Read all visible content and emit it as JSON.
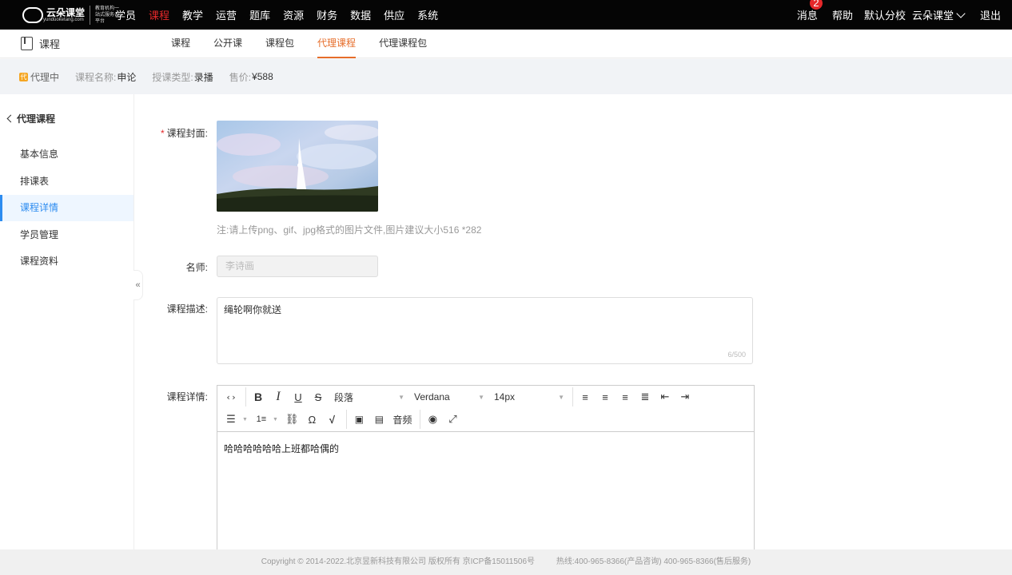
{
  "brand": {
    "name": "云朵课堂",
    "domain_text": "yunduoketang.com",
    "tagline": "教育机构一站式服务云平台"
  },
  "nav": {
    "items": [
      "学员",
      "课程",
      "教学",
      "运营",
      "题库",
      "资源",
      "财务",
      "数据",
      "供应",
      "系统"
    ],
    "active": "课程"
  },
  "right_nav": {
    "messages": "消息",
    "message_count": "2",
    "help": "帮助",
    "branch": "默认分校",
    "account": "云朵课堂",
    "logout": "退出"
  },
  "subheader": {
    "title": "课程",
    "tabs": [
      "课程",
      "公开课",
      "课程包",
      "代理课程",
      "代理课程包"
    ],
    "active_tab": "代理课程"
  },
  "infobar": {
    "status": "代理中",
    "name_label": "课程名称:",
    "name_value": "申论",
    "type_label": "授课类型:",
    "type_value": "录播",
    "price_label": "售价:",
    "price_value": "¥588"
  },
  "sidebar": {
    "back_label": "代理课程",
    "items": [
      "基本信息",
      "排课表",
      "课程详情",
      "学员管理",
      "课程资料"
    ],
    "active": "课程详情",
    "collapse_glyph": "«"
  },
  "form": {
    "cover_label": "课程封面:",
    "cover_note": "注:请上传png、gif、jpg格式的图片文件,图片建议大小516 *282",
    "teacher_label": "名师:",
    "teacher_placeholder": "李诗画",
    "desc_label": "课程描述:",
    "desc_value": "绳轮啊你就送",
    "desc_counter": "6/500",
    "detail_label": "课程详情:"
  },
  "editor": {
    "paragraph": "段落",
    "font": "Verdana",
    "size": "14px",
    "audio": "音频",
    "content": "哈哈哈哈哈哈上班都哈偶的",
    "icons": [
      "code-icon",
      "bold-icon",
      "italic-icon",
      "underline-icon",
      "strikethrough-icon",
      "align-left-icon",
      "align-center-icon",
      "align-right-icon",
      "align-justify-icon",
      "outdent-icon",
      "indent-icon",
      "bullet-list-icon",
      "numbered-list-icon",
      "link-icon",
      "special-char-icon",
      "formula-icon",
      "image-icon",
      "video-icon",
      "preview-icon",
      "fullscreen-icon"
    ]
  },
  "footer": {
    "copyright": "Copyright © 2014-2022.北京昱新科技有限公司 版权所有 京ICP备15011506号",
    "hotline": "热线:400-965-8366(产品咨询) 400-965-8366(售后服务)"
  }
}
